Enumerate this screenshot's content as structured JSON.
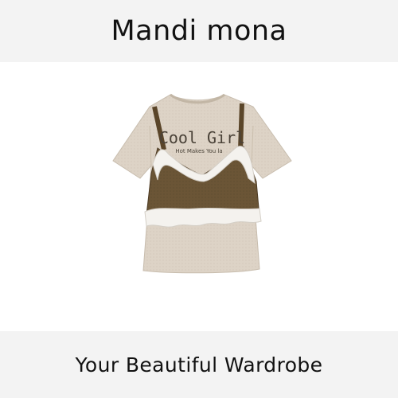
{
  "header": {
    "brand": "Mandi mona"
  },
  "product": {
    "graphic_text": "Cool Girl",
    "graphic_subtext": "Hot Makes You la",
    "colors": {
      "tee": "#ddd3c6",
      "camisole": "#6b5536",
      "lace": "#f4f2ee"
    }
  },
  "footer": {
    "tagline": "Your Beautiful Wardrobe"
  }
}
